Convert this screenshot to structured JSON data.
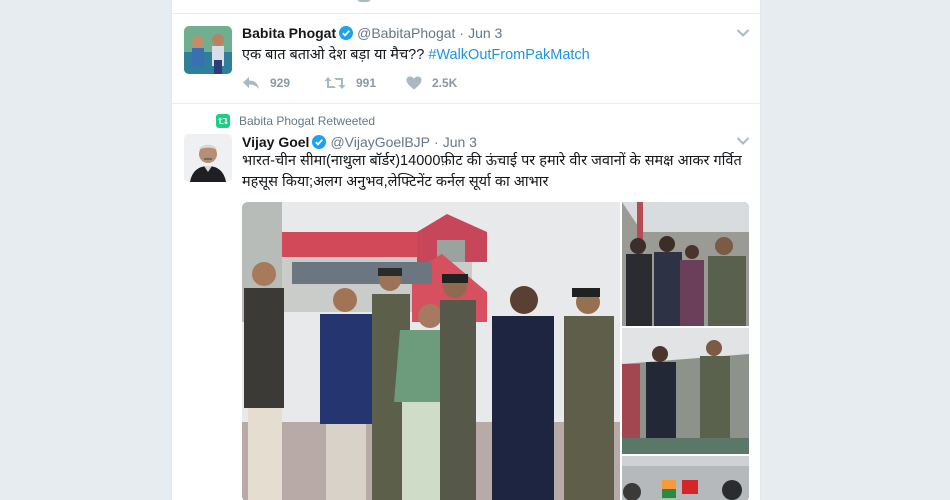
{
  "tweets": [
    {
      "fullname": "Babita Phogat",
      "username": "@BabitaPhogat",
      "separator": "·",
      "time": "Jun 3",
      "text_plain": "एक बात बताओ देश बड़ा या मैच?? ",
      "hashtag": "#WalkOutFromPakMatch",
      "reply_count": "929",
      "retweet_count": "991",
      "like_count": "2.5K"
    },
    {
      "retweet_context": "Babita Phogat Retweeted",
      "fullname": "Vijay Goel",
      "username": "@VijayGoelBJP",
      "separator": "·",
      "time": "Jun 3",
      "text": "भारत-चीन सीमा(नाथुला बॉर्डर)14000फ़ीट की ऊंचाई पर हमारे वीर जवानों के समक्ष आकर गर्वित महसूस किया;अलग अनुभव,लेफ्टिनेंट कर्नल सूर्या का आभार"
    }
  ],
  "icons": {
    "verified": "verified-badge-icon",
    "reply": "reply-icon",
    "retweet": "retweet-icon",
    "like": "heart-icon",
    "caret": "chevron-down-icon"
  },
  "colors": {
    "link": "#1b95e0",
    "verified": "#1da1f2",
    "retweet_badge": "#19cf86",
    "muted": "#657786",
    "action": "#aab8c2"
  }
}
